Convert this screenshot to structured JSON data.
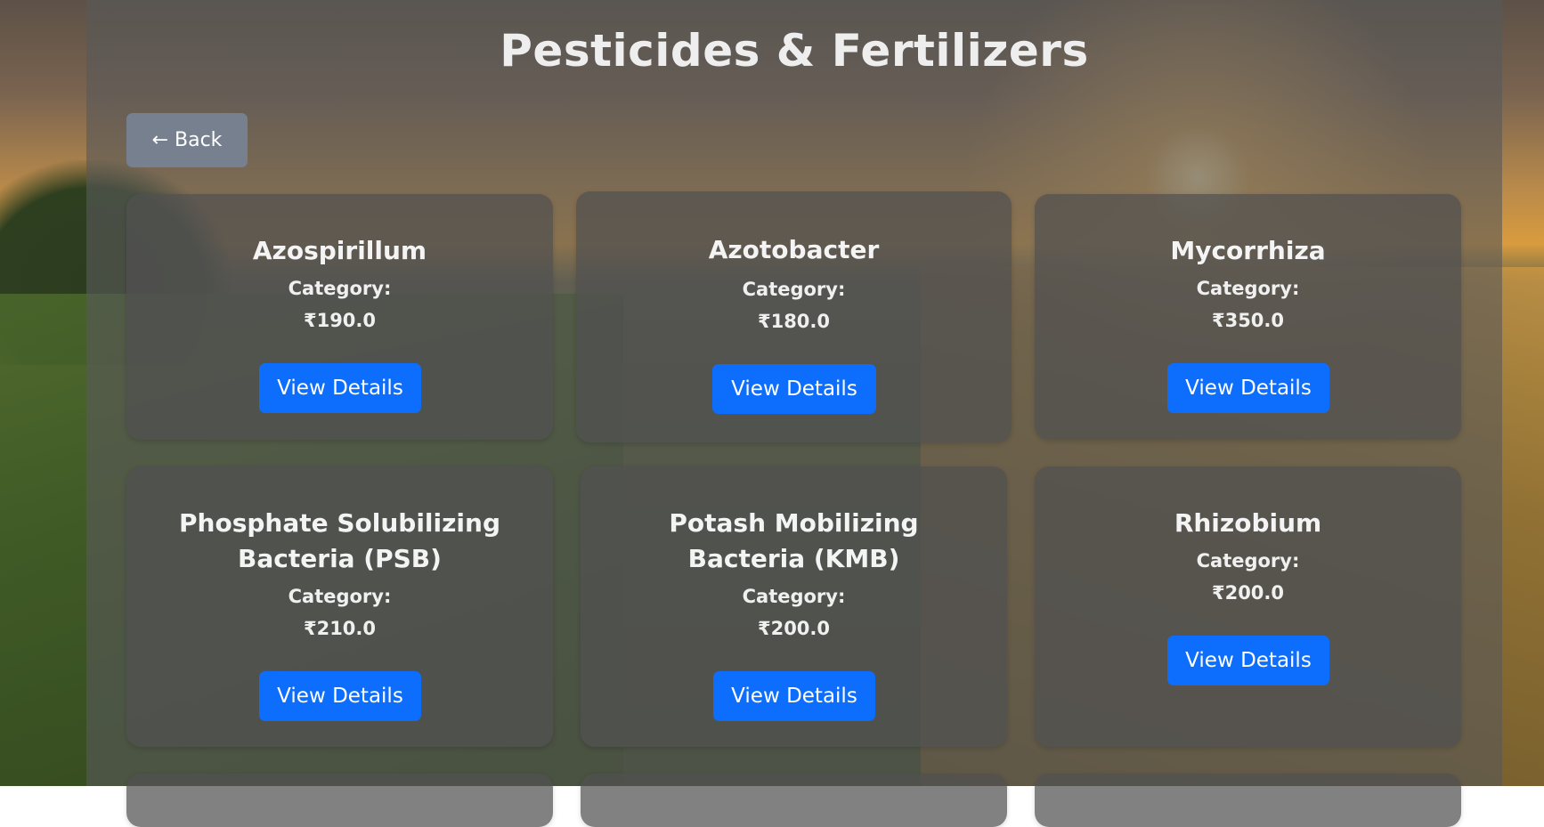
{
  "page": {
    "title": "Pesticides & Fertilizers",
    "back_label": "← Back"
  },
  "products": [
    {
      "name": "Azospirillum",
      "category_label": "Category:",
      "price": "₹190.0",
      "button_label": "View Details"
    },
    {
      "name": "Azotobacter",
      "category_label": "Category:",
      "price": "₹180.0",
      "button_label": "View Details"
    },
    {
      "name": "Mycorrhiza",
      "category_label": "Category:",
      "price": "₹350.0",
      "button_label": "View Details"
    },
    {
      "name": "Phosphate Solubilizing Bacteria (PSB)",
      "category_label": "Category:",
      "price": "₹210.0",
      "button_label": "View Details"
    },
    {
      "name": "Potash Mobilizing Bacteria (KMB)",
      "category_label": "Category:",
      "price": "₹200.0",
      "button_label": "View Details"
    },
    {
      "name": "Rhizobium",
      "category_label": "Category:",
      "price": "₹200.0",
      "button_label": "View Details"
    }
  ],
  "colors": {
    "button_primary": "#0d6efd",
    "back_button": "#76808e",
    "panel_overlay": "#585858"
  }
}
